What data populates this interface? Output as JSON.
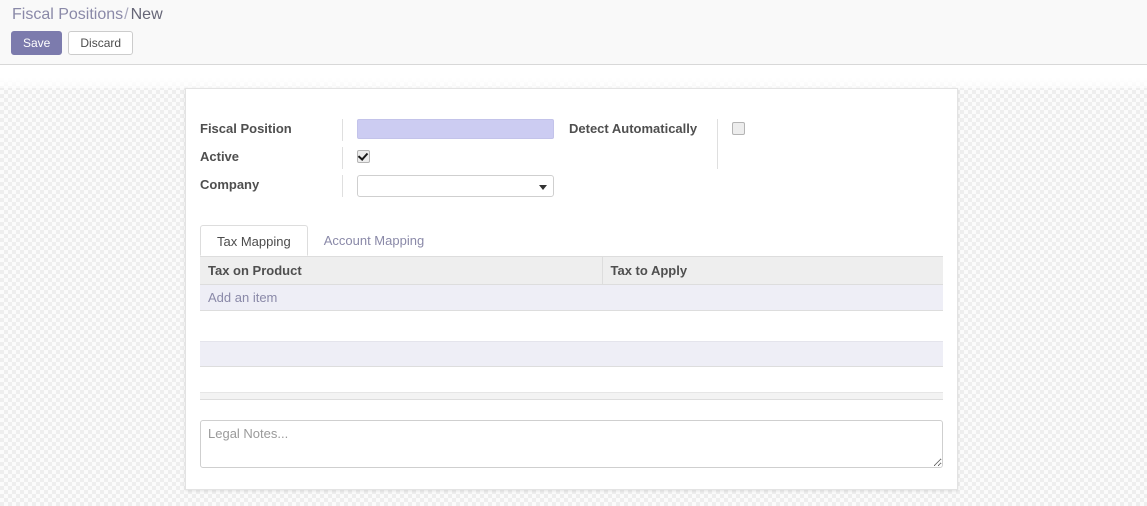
{
  "breadcrumb": {
    "root": "Fiscal Positions",
    "separator": "/",
    "current": "New"
  },
  "toolbar": {
    "save_label": "Save",
    "discard_label": "Discard"
  },
  "form": {
    "left_fields": [
      {
        "label": "Fiscal Position",
        "type": "text",
        "value": "",
        "placeholder": ""
      },
      {
        "label": "Active",
        "type": "checkbox",
        "checked": true
      },
      {
        "label": "Company",
        "type": "select",
        "value": ""
      }
    ],
    "right_fields": [
      {
        "label": "Detect Automatically",
        "type": "checkbox",
        "checked": false
      }
    ]
  },
  "notebook": {
    "tabs": [
      {
        "label": "Tax Mapping",
        "active": true
      },
      {
        "label": "Account Mapping",
        "active": false
      }
    ],
    "table": {
      "columns": [
        "Tax on Product",
        "Tax to Apply"
      ],
      "rows": [],
      "add_label": "Add an item"
    }
  },
  "notes": {
    "value": "",
    "placeholder": "Legal Notes..."
  },
  "colors": {
    "accent": "#7c7bad",
    "focus_field_bg": "#ccccf2",
    "row_bg": "#eeeef6",
    "header_bg": "#eeeeee",
    "muted_text": "#8a89a8"
  },
  "icons": {
    "dropdown": "chevron-down-icon",
    "resize": "resize-handle-icon"
  }
}
